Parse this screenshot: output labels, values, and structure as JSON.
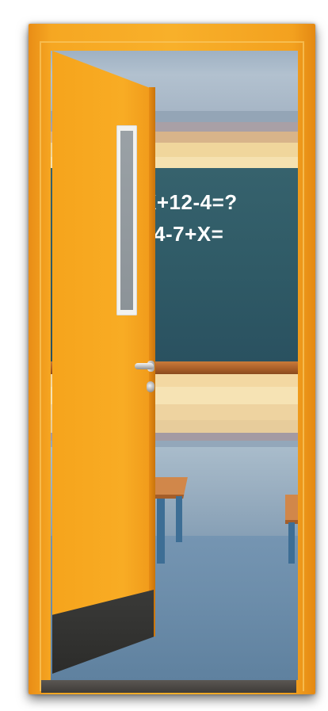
{
  "board": {
    "line1": "X+12-4=?",
    "line2": "4-7+X="
  },
  "colors": {
    "door": "#f8ac24",
    "frame": "#f6a722",
    "chalkboard": "#2f5a66",
    "kickplate": "#2f2f2d"
  },
  "icons": [
    "door-handle-icon",
    "door-lock-icon"
  ]
}
